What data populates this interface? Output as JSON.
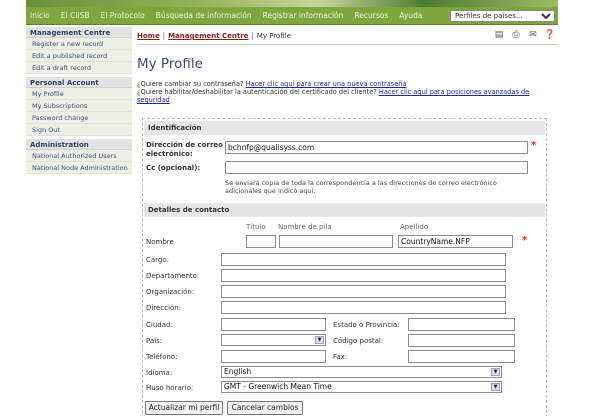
{
  "topnav": {
    "items": [
      "Inicio",
      "El CIISB",
      "El Protocolo",
      "Búsqueda de información",
      "Registrar información",
      "Recursos",
      "Ayuda"
    ],
    "profile_select": "Perfiles de países..."
  },
  "sidebar": {
    "groups": [
      {
        "heading": "Management Centre",
        "items": [
          "Register a new record",
          "Edit a published record",
          "Edit a draft record"
        ]
      },
      {
        "heading": "Personal Account",
        "items": [
          "My Profile",
          "My Subscriptions",
          "Password change",
          "Sign Out"
        ]
      },
      {
        "heading": "Administration",
        "items": [
          "National Authorized Users",
          "National Node Administration"
        ]
      }
    ]
  },
  "breadcrumb": {
    "home": "Home",
    "section": "Management Centre",
    "current": "My Profile"
  },
  "page": {
    "title": "My Profile",
    "pw_question": "¿Quiere cambiar su contraseña?",
    "pw_link": "Hacer clic aquí para crear una nueva contraseña",
    "cert_question": "¿Quiere habilitar/deshabilitar la autenticación del certificado del cliente?",
    "cert_link": "Hacer clic aquí para posiciones avanzadas de seguridad"
  },
  "form": {
    "sec_id": "Identificación",
    "email_label": "Dirección de correo electrónico:",
    "email_value": "bchnfp@qualisyss.com",
    "cc_label": "Cc (opcional):",
    "cc_value": "",
    "cc_hint": "Se enviará copia de toda la correspondencia a las direcciones de correo electrónico adicionales que indicó aquí.",
    "sec_contact": "Detalles de contacto",
    "col_titulo": "Título",
    "col_nombre": "Nombre de pila",
    "col_apellido": "Apellido",
    "nombre_label": "Nombre",
    "titulo_value": "",
    "nombre_value": "",
    "apellido_value": "CountryName.NFP",
    "cargo_label": "Cargo:",
    "depto_label": "Departamento:",
    "org_label": "Organización:",
    "dir_label": "Dirección:",
    "ciudad_label": "Ciudad:",
    "estado_label": "Estado o Provincia:",
    "pais_label": "País:",
    "pais_value": "",
    "cp_label": "Código postal:",
    "tel_label": "Teléfono:",
    "fax_label": "Fax:",
    "idioma_label": "Idioma:",
    "idioma_value": "English",
    "huso_label": "Huso horario:",
    "huso_value": "GMT - Greenwich Mean Time",
    "update_btn": "Actualizar mi perfil",
    "cancel_btn": "Cancelar cambios"
  },
  "icons": [
    "print-preview-icon",
    "print-icon",
    "email-icon",
    "help-icon"
  ]
}
